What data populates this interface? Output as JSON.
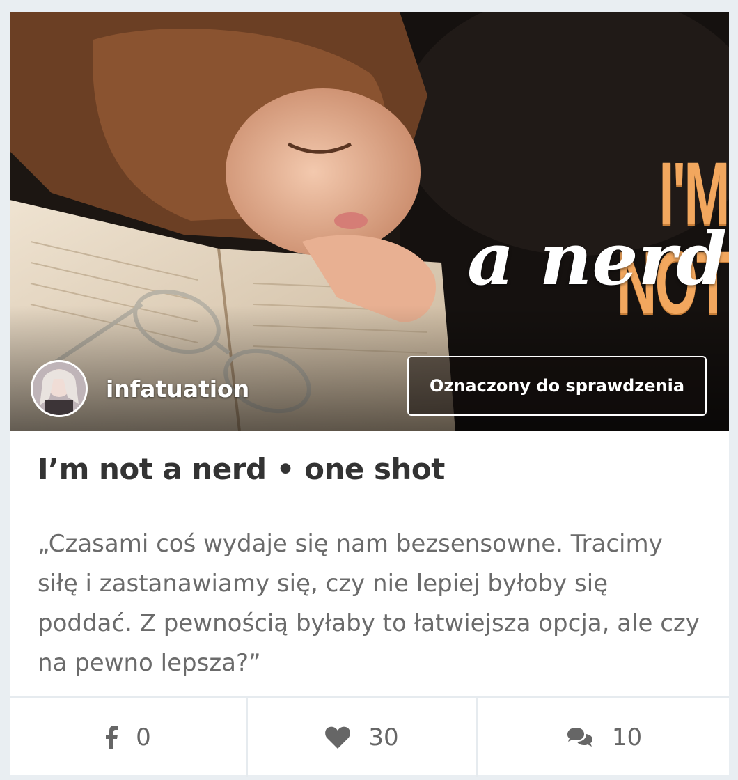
{
  "cover": {
    "title_line1": "I'M NOT",
    "title_line2": "a nerd"
  },
  "author": {
    "name": "infatuation"
  },
  "status_badge": "Oznaczony do sprawdzenia",
  "post": {
    "title": "I’m not a nerd • one shot",
    "excerpt": "„Czasami coś wydaje się nam bezsensowne. Tracimy siłę i zastanawiamy się, czy nie lepiej byłoby się poddać. Z pewnością byłaby to łatwiejsza opcja, ale czy na pewno lepsza?”"
  },
  "actions": {
    "facebook": {
      "icon": "facebook-icon",
      "count": "0"
    },
    "likes": {
      "icon": "heart-icon",
      "count": "30"
    },
    "comments": {
      "icon": "comments-icon",
      "count": "10"
    }
  },
  "colors": {
    "title_orange": "#f2a75e",
    "text_dark": "#333333",
    "text_muted": "#6b6b6b",
    "icon_gray": "#666666"
  }
}
